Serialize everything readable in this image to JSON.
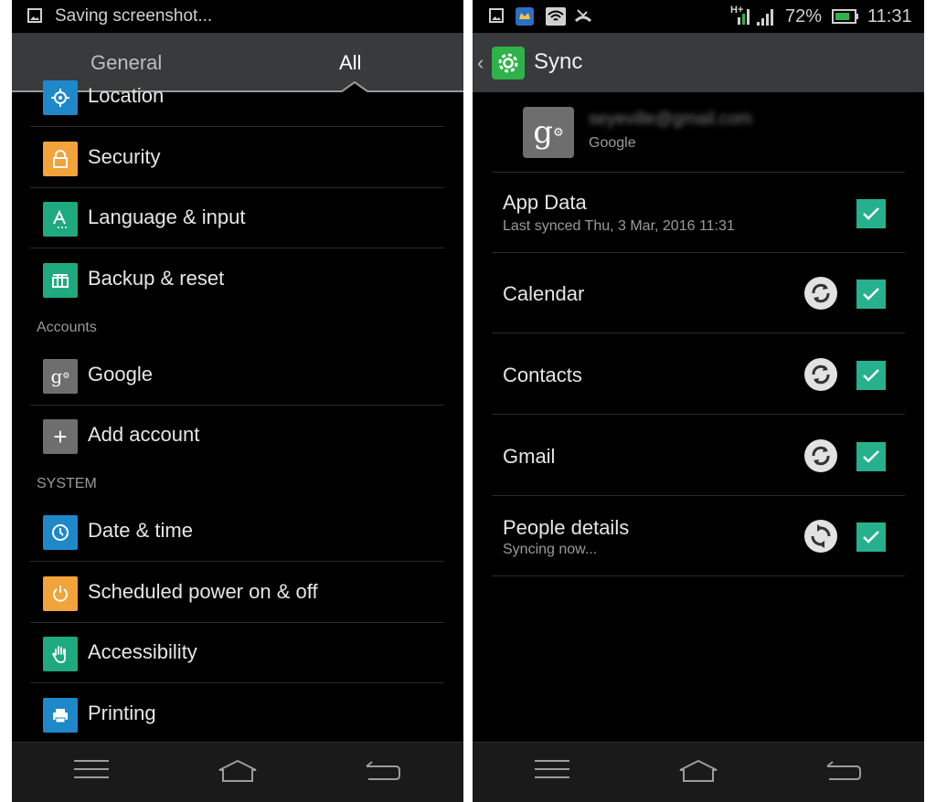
{
  "left_phone": {
    "status_text": "Saving screenshot...",
    "tabs": [
      {
        "label": "General"
      },
      {
        "label": "All"
      }
    ],
    "items_top": [
      {
        "label": "Location",
        "icon": "location-icon",
        "color": "#1e88c9"
      },
      {
        "label": "Security",
        "icon": "lock-icon",
        "color": "#f2a33a"
      },
      {
        "label": "Language & input",
        "icon": "keyboard-icon",
        "color": "#1fa97e"
      },
      {
        "label": "Backup & reset",
        "icon": "backup-icon",
        "color": "#1fa97e"
      }
    ],
    "accounts_header": "Accounts",
    "account_items": [
      {
        "label": "Google",
        "icon": "google-icon",
        "color": "#6e6e6e"
      },
      {
        "label": "Add account",
        "icon": "plus-icon",
        "color": "#6e6e6e"
      }
    ],
    "system_header": "SYSTEM",
    "system_items": [
      {
        "label": "Date & time",
        "icon": "clock-icon",
        "color": "#1e88c9"
      },
      {
        "label": "Scheduled power on & off",
        "icon": "power-icon",
        "color": "#f2a33a"
      },
      {
        "label": "Accessibility",
        "icon": "hand-icon",
        "color": "#1fa97e"
      },
      {
        "label": "Printing",
        "icon": "printer-icon",
        "color": "#1e88c9"
      }
    ]
  },
  "right_phone": {
    "status": {
      "battery": "72%",
      "time": "11:31",
      "network": "H+"
    },
    "header_title": "Sync",
    "account": {
      "email": "seyeville@gmail.com",
      "type": "Google"
    },
    "sync_items": [
      {
        "name": "App Data",
        "subtitle": "Last synced Thu, 3 Mar, 2016 11:31",
        "checked": true,
        "show_sync_icon": false
      },
      {
        "name": "Calendar",
        "subtitle": "",
        "checked": true,
        "show_sync_icon": true
      },
      {
        "name": "Contacts",
        "subtitle": "",
        "checked": true,
        "show_sync_icon": true
      },
      {
        "name": "Gmail",
        "subtitle": "",
        "checked": true,
        "show_sync_icon": true
      },
      {
        "name": "People details",
        "subtitle": "Syncing now...",
        "checked": true,
        "show_sync_icon": true
      }
    ]
  },
  "colors": {
    "checkbox": "#27b08d",
    "header_bg": "#383a3c",
    "settings_green": "#2fb24a"
  }
}
